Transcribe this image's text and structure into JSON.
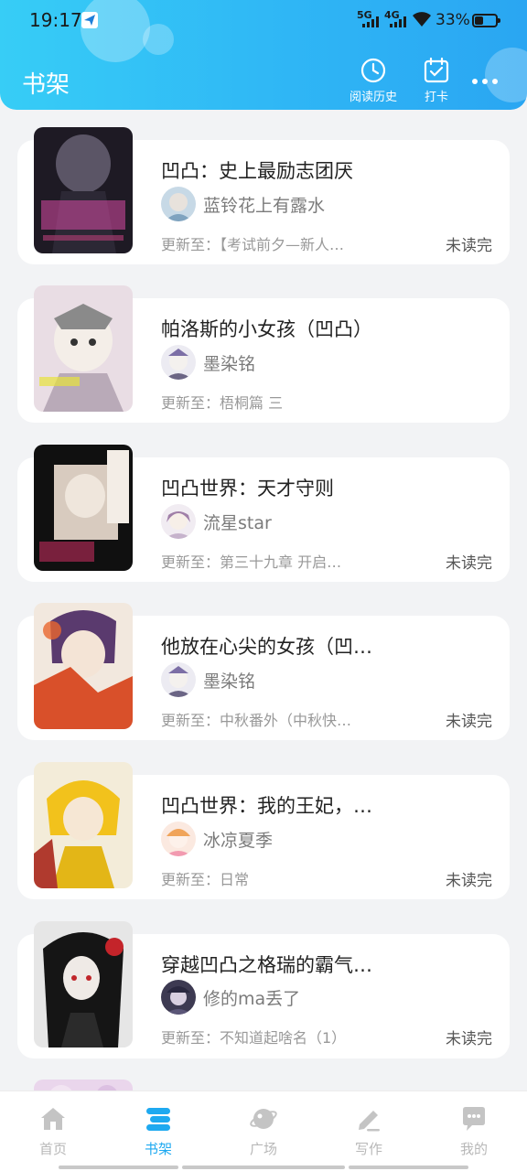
{
  "status_bar": {
    "time": "19:17",
    "signal1": "5G",
    "signal2": "4G",
    "battery": "33%"
  },
  "header": {
    "title": "书架",
    "history_label": "阅读历史",
    "checkin_label": "打卡"
  },
  "books": [
    {
      "title": "凹凸：史上最励志团厌",
      "author": "蓝铃花上有露水",
      "update": "更新至：【考试前夕—新人…",
      "status": "未读完"
    },
    {
      "title": "帕洛斯的小女孩（凹凸）",
      "author": "墨染铭",
      "update": "更新至：梧桐篇 三",
      "status": ""
    },
    {
      "title": "凹凸世界：天才守则",
      "author": "流星star",
      "update": "更新至：第三十九章  开启…",
      "status": "未读完"
    },
    {
      "title": "他放在心尖的女孩（凹…",
      "author": "墨染铭",
      "update": "更新至：中秋番外（中秋快…",
      "status": "未读完"
    },
    {
      "title": "凹凸世界：我的王妃，…",
      "author": "冰凉夏季",
      "update": "更新至：日常",
      "status": "未读完"
    },
    {
      "title": "穿越凹凸之格瑞的霸气…",
      "author": "修的ma丢了",
      "update": "更新至：不知道起啥名（1）",
      "status": "未读完"
    }
  ],
  "nav": {
    "home": "首页",
    "shelf": "书架",
    "square": "广场",
    "write": "写作",
    "mine": "我的"
  },
  "colors": {
    "accent": "#1ea9f0",
    "header_start": "#37cdf6",
    "header_end": "#2aa6f2"
  }
}
